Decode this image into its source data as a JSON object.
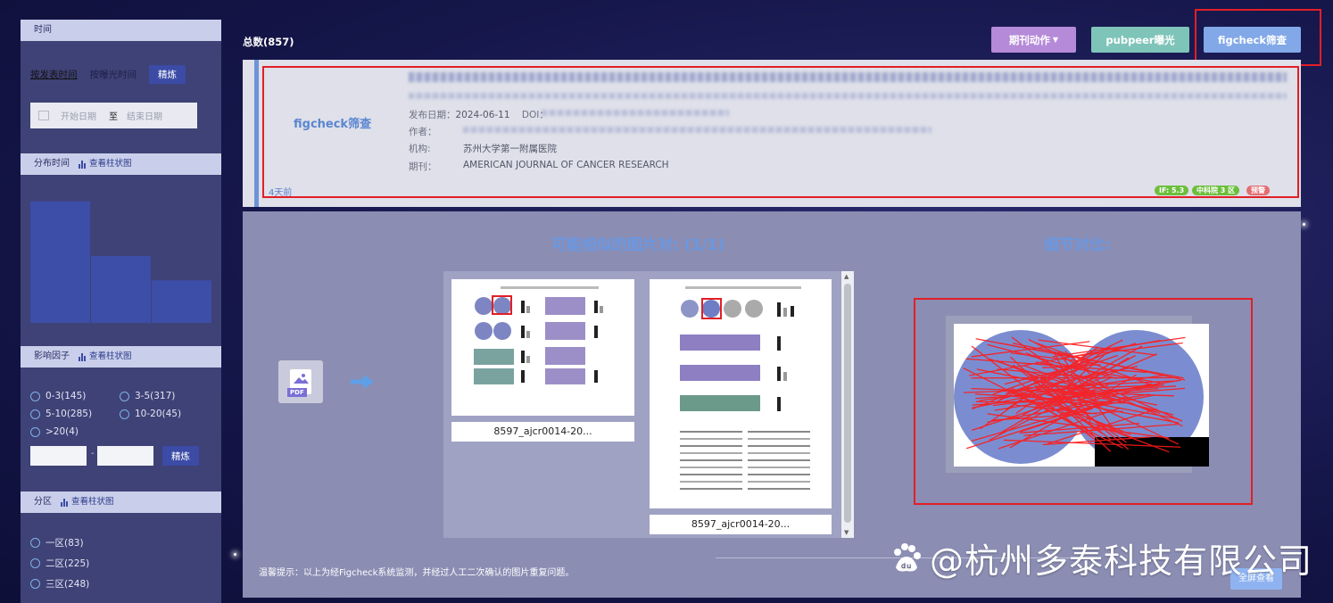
{
  "sidebar": {
    "time_header": "时间",
    "tab_publish": "按发表时间",
    "tab_exposure": "按曝光时间",
    "refine_label": "精炼",
    "date_start_placeholder": "开始日期",
    "date_sep": "至",
    "date_end_placeholder": "结束日期",
    "distribution_header": "分布时间",
    "view_chart": "查看柱状图",
    "impact_header": "影响因子",
    "impact_options": [
      "0-3(145)",
      "3-5(317)",
      "5-10(285)",
      "10-20(45)",
      ">20(4)"
    ],
    "range_sep": "-",
    "partition_header": "分区",
    "partition_options": [
      "一区(83)",
      "二区(225)",
      "三区(248)"
    ]
  },
  "chart_data": {
    "type": "bar",
    "categories": [
      "",
      "",
      ""
    ],
    "values": [
      100,
      55,
      35
    ],
    "title": "",
    "xlabel": "",
    "ylabel": "",
    "ylim": [
      0,
      110
    ]
  },
  "header": {
    "total": "总数(857)",
    "journal_action": "期刊动作",
    "pubpeer": "pubpeer曝光",
    "figcheck": "figcheck筛查"
  },
  "card": {
    "figcheck_label": "figcheck筛查",
    "publish_label": "发布日期：",
    "publish_date": "2024-06-11",
    "doi_label": "DOI：",
    "author_label": "作者：",
    "org_label": "机构:",
    "org": "苏州大学第一附属医院",
    "journal_label": "期刊：",
    "journal": "AMERICAN JOURNAL OF CANCER RESEARCH",
    "ago": "4天前",
    "badge_if": "IF: 5.3",
    "badge_zone": "中科院 3 区",
    "badge_warn": "预警"
  },
  "panel": {
    "similar_title": "可能相似的图片对: (1/1)",
    "detail_title": "细节对比:",
    "pdf_tag": "PDF",
    "caption_1": "8597_ajcr0014-20...",
    "caption_2": "8597_ajcr0014-20...",
    "tip": "温馨提示：以上为经Figcheck系统监测，并经过人工二次确认的图片重复问题。",
    "fullscreen": "全屏查看"
  },
  "watermark": "@杭州多泰科技有限公司",
  "colors": {
    "accent_red": "#e21f26",
    "brand_blue": "#6a98e2"
  }
}
